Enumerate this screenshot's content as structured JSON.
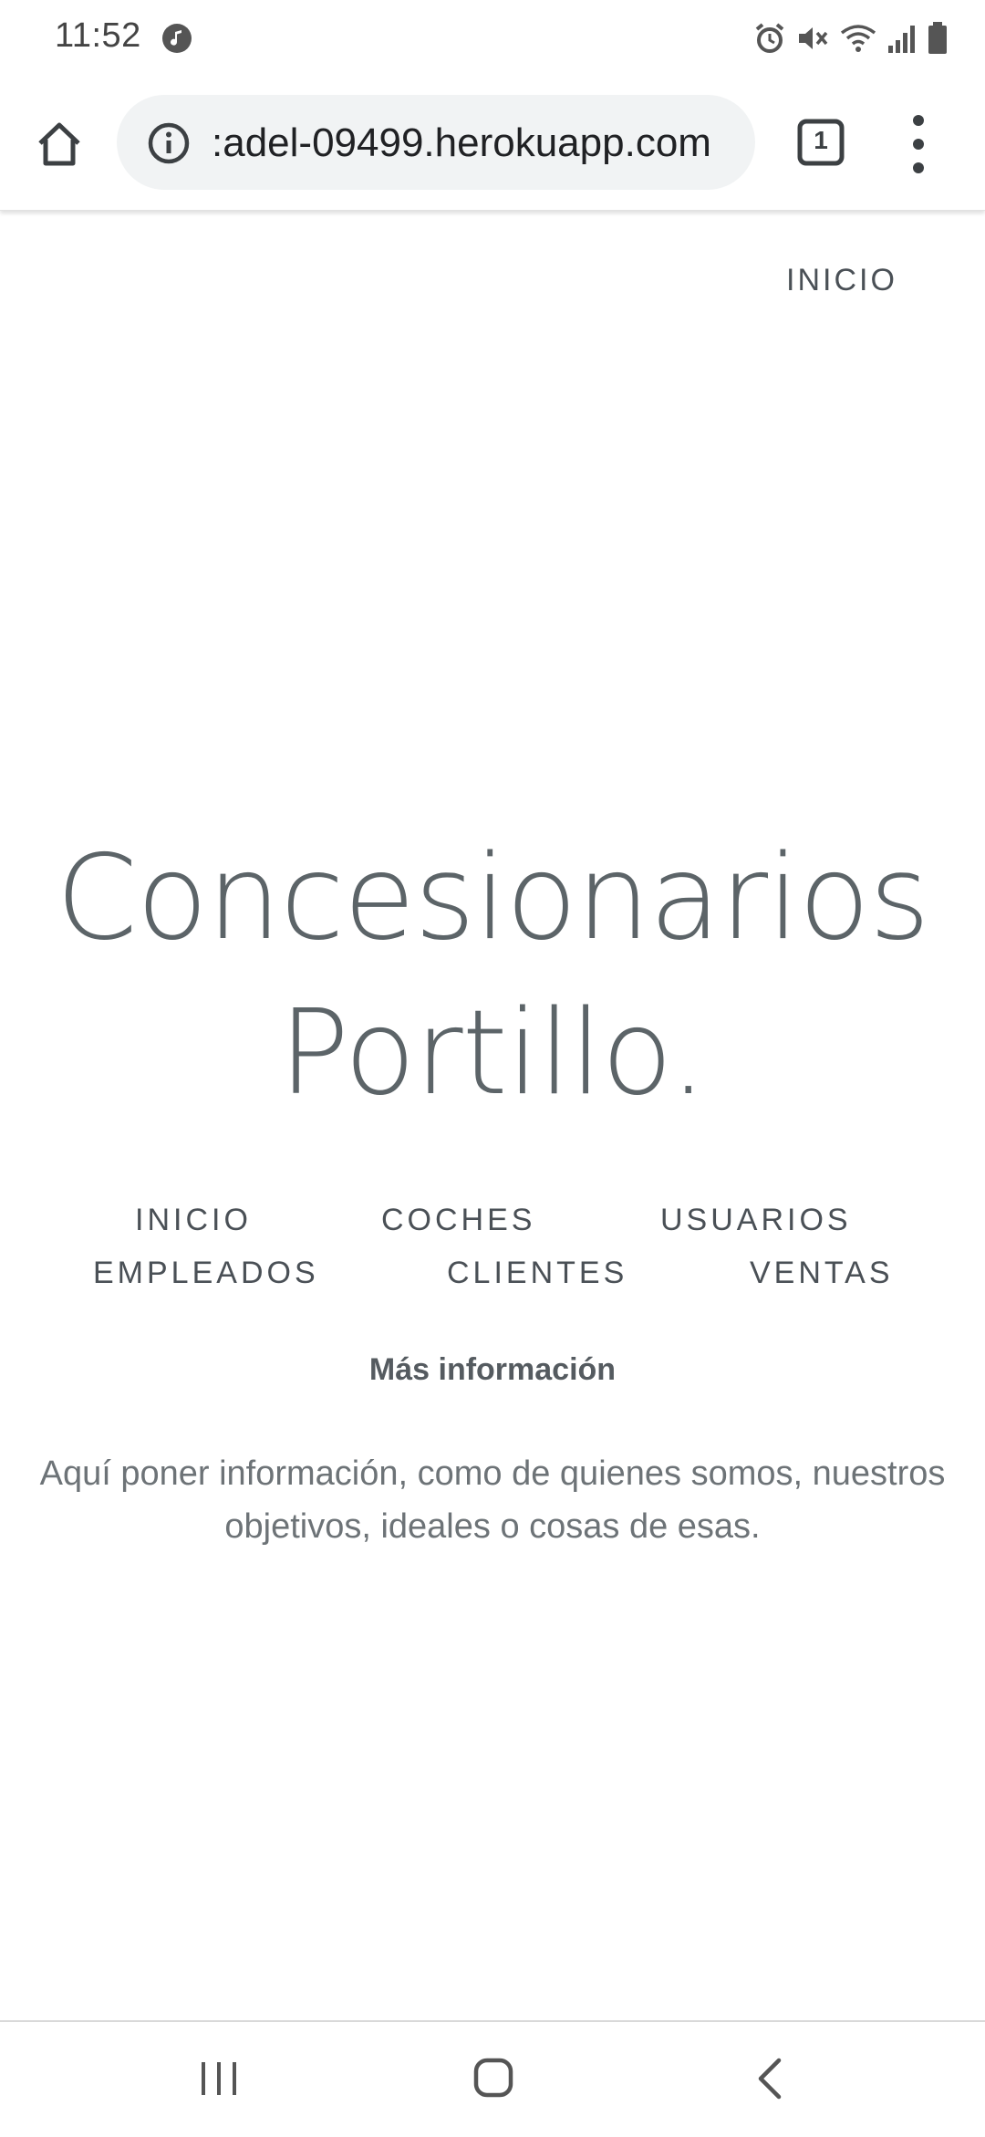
{
  "status_bar": {
    "time": "11:52",
    "icons": [
      "music-note-icon",
      "alarm-icon",
      "mute-icon",
      "wifi-icon",
      "signal-icon",
      "battery-icon"
    ]
  },
  "browser": {
    "url": ":adel-09499.herokuapp.com",
    "tab_count": "1"
  },
  "page": {
    "top_nav_link": "INICIO",
    "title_line1": "Concesionarios",
    "title_line2": "Portillo.",
    "nav": {
      "inicio": "INICIO",
      "coches": "COCHES",
      "usuarios": "USUARIOS",
      "empleados": "EMPLEADOS",
      "clientes": "CLIENTES",
      "ventas": "VENTAS"
    },
    "more_info": "Más información",
    "description_line1": "Aquí poner información, como de quienes somos, nuestros",
    "description_line2": "objetivos, ideales o cosas de esas."
  },
  "colors": {
    "text_heading": "#5c6468",
    "text_nav": "#4a5056",
    "url_bar_bg": "#f1f3f4"
  }
}
